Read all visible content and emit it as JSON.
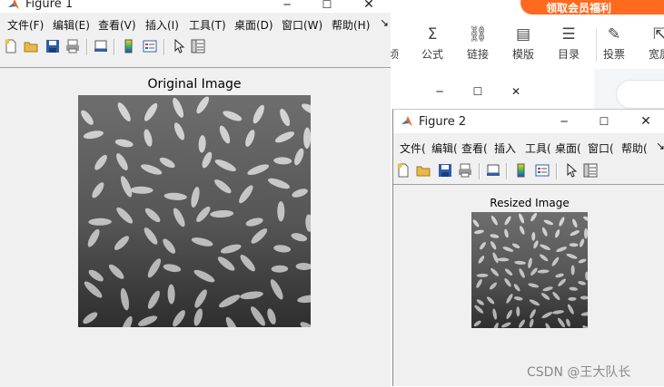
{
  "background_app": {
    "banner_text": "领取会员福利",
    "ribbon_items": [
      {
        "icon": "sigma-icon",
        "glyph": "Σ",
        "label": "公式"
      },
      {
        "icon": "link-icon",
        "glyph": "⛓",
        "label": "链接"
      },
      {
        "icon": "template-icon",
        "glyph": "▤",
        "label": "模版"
      },
      {
        "icon": "toc-icon",
        "glyph": "☰",
        "label": "目录"
      },
      {
        "icon": "vote-icon",
        "glyph": "✎",
        "label": "投票"
      },
      {
        "icon": "wide-icon",
        "glyph": "⇱",
        "label": "宽屏"
      }
    ],
    "partial_left_label": "顷"
  },
  "figure1": {
    "title": "Figure 1",
    "menu": [
      "文件(F)",
      "编辑(E)",
      "查看(V)",
      "插入(I)",
      "工具(T)",
      "桌面(D)",
      "窗口(W)",
      "帮助(H)"
    ],
    "more_glyph": "↘",
    "axes_title": "Original Image"
  },
  "figure2": {
    "title": "Figure 2",
    "menu": [
      "文件(",
      "编辑(",
      "查看(",
      "插入",
      "工具(",
      "桌面(",
      "窗口(",
      "帮助("
    ],
    "more_glyph": "↘",
    "axes_title": "Resized Image"
  },
  "watermark": "CSDN @王大队长",
  "colors": {
    "accent_orange": "#ff6a1f",
    "matlab_bg": "#f0f0f0"
  }
}
